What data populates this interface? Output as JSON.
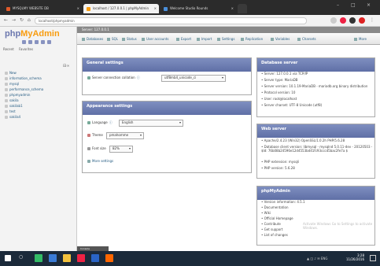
{
  "browser": {
    "tabs": [
      {
        "label": "MYSQLMY WEBSITE  DB",
        "active": false,
        "color": "#e05a2a"
      },
      {
        "label": "localhost / 127.0.0.1 | phpMyAdmin",
        "active": true,
        "color": "#f89c0e"
      },
      {
        "label": "Welcome Studio Rounds",
        "active": false,
        "color": "#4a8fdb"
      }
    ],
    "url": "localhost/phpmyadmin",
    "window_controls": [
      "–",
      "□",
      "×"
    ]
  },
  "sidebar": {
    "logo_main": "php",
    "logo_accent": "MyAdmin",
    "recent": "Recent",
    "favorites": "Favorites",
    "collapse_label": "⊟∞",
    "tree": [
      "New",
      "information_schema",
      "mysql",
      "performance_schema",
      "phpmyadmin",
      "sakila",
      "sakilab1",
      "test",
      "sakila4"
    ]
  },
  "breadcrumb": "Server: 127.0.0.1",
  "tabs": [
    "Databases",
    "SQL",
    "Status",
    "User accounts",
    "Export",
    "Import",
    "Settings",
    "Replication",
    "Variables",
    "Charsets",
    "More"
  ],
  "general": {
    "title": "General settings",
    "collation_label": "Server connection collation",
    "collation_value": "utf8mb4_unicode_ci"
  },
  "appearance": {
    "title": "Appearance settings",
    "language_label": "Language",
    "language_value": "English",
    "theme_label": "Theme",
    "theme_value": "pmahomme",
    "fontsize_label": "Font size",
    "fontsize_value": "82%",
    "more": "More settings"
  },
  "dbserver": {
    "title": "Database server",
    "items": [
      "Server: 127.0.0.1 via TCP/IP",
      "Server type: MariaDB",
      "Server version: 10.1.19-MariaDB - mariadb.org binary distribution",
      "Protocol version: 10",
      "User: root@localhost",
      "Server charset: UTF-8 Unicode (utf8)"
    ]
  },
  "webserver": {
    "title": "Web server",
    "items": [
      "Apache/2.4.23 (Win32) OpenSSL/1.0.2h PHP/5.6.28",
      "Database client version: libmysql - mysqlnd 5.0.11-dev - 20120503 - $Id: 76b08b24596e12d4553bd41fc93cccd5bac2fe7a $",
      "PHP extension: mysqli",
      "PHP version: 5.6.28"
    ]
  },
  "pma": {
    "title": "phpMyAdmin",
    "items": [
      "Version information: 4.5.1",
      "Documentation",
      "Wiki",
      "Official Homepage",
      "Contribute",
      "Get support",
      "List of changes"
    ],
    "note": "Activate Windows Go to Settings to activate Windows."
  },
  "console": "Console",
  "taskbar": {
    "time": "3:28",
    "date": "11/26/2016"
  }
}
